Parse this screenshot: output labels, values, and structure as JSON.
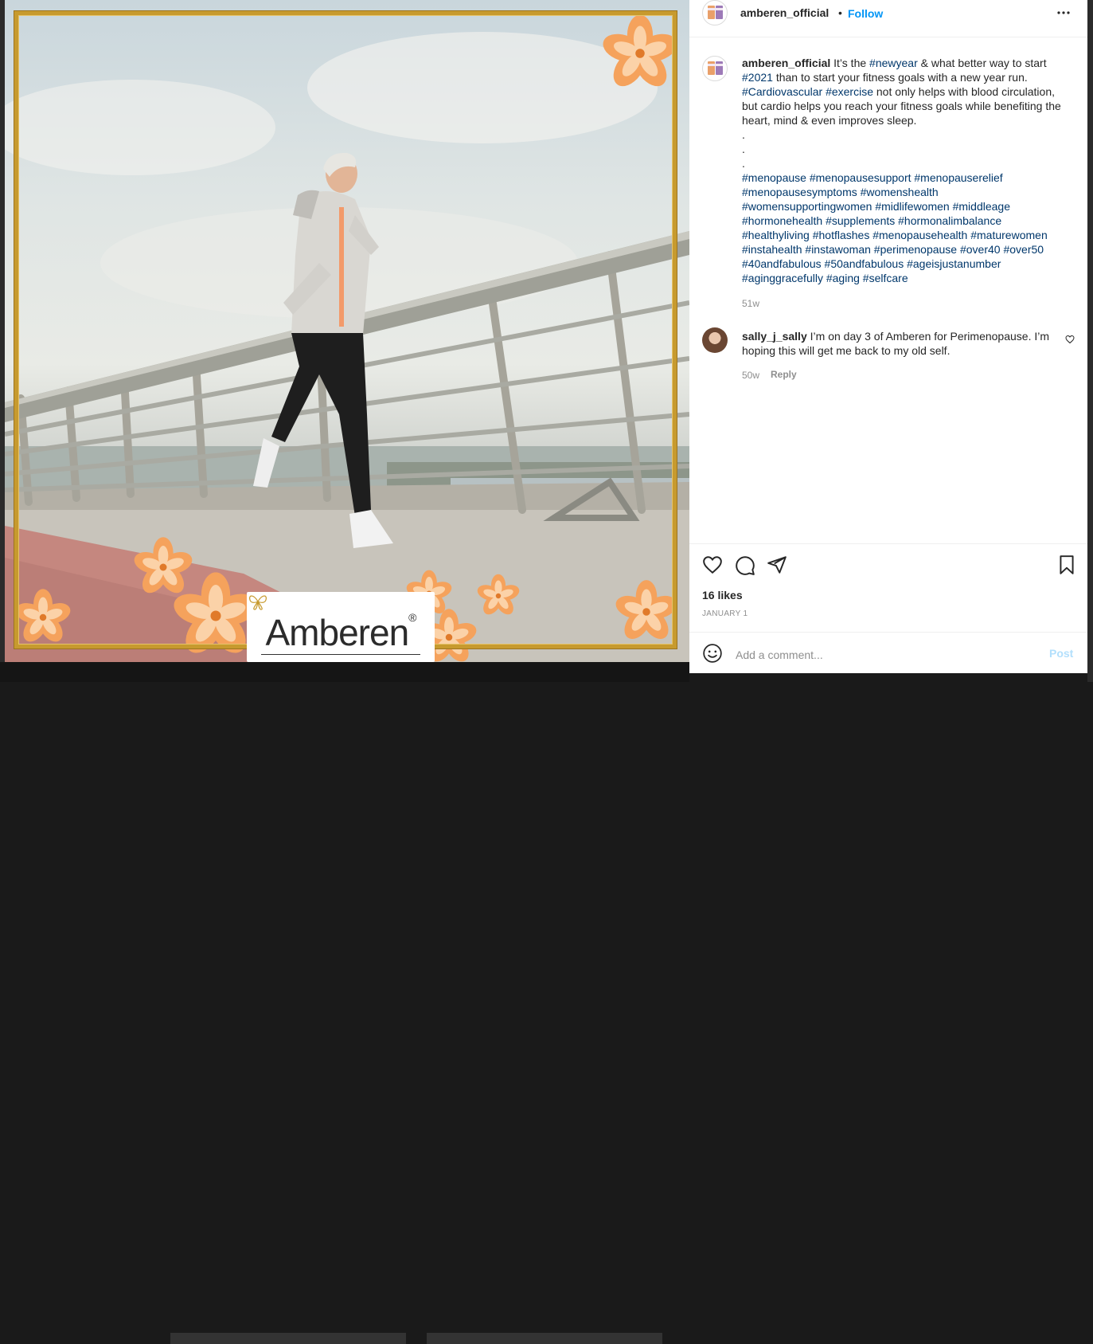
{
  "post": {
    "logo_text": "Amberen",
    "logo_mark": "®"
  },
  "header": {
    "username": "amberen_official",
    "separator": "•",
    "follow_label": "Follow",
    "more_icon": "more-horizontal-icon"
  },
  "caption": {
    "username": "amberen_official",
    "segments": [
      {
        "t": "It’s the "
      },
      {
        "t": "#newyear",
        "tag": true
      },
      {
        "t": " & what better way to start "
      },
      {
        "t": "#2021",
        "tag": true
      },
      {
        "t": " than to start your fitness goals with a new year run. "
      },
      {
        "t": "#Cardiovascular",
        "tag": true
      },
      {
        "t": " "
      },
      {
        "t": "#exercise",
        "tag": true
      },
      {
        "t": " not only helps with blood circulation, but cardio helps you reach your fitness goals while benefiting the heart, mind & even improves sleep.\n.\n.\n.\n"
      }
    ],
    "hashtag_lines": [
      [
        "#menopause",
        "#menopausesupport",
        "#menopauserelief"
      ],
      [
        "#menopausesymptoms",
        "#womenshealth"
      ],
      [
        "#womensupportingwomen",
        "#midlifewomen",
        "#middleage"
      ],
      [
        "#hormonehealth",
        "#supplements",
        "#hormonalimbalance"
      ],
      [
        "#healthyliving",
        "#hotflashes",
        "#menopausehealth",
        "#maturewomen"
      ],
      [
        "#instahealth",
        "#instawoman",
        "#perimenopause",
        "#over40",
        "#over50"
      ],
      [
        "#40andfabulous",
        "#50andfabulous",
        "#ageisjustanumber"
      ],
      [
        "#aginggracefully",
        "#aging",
        "#selfcare"
      ]
    ],
    "time": "51w"
  },
  "comment": {
    "username": "sally_j_sally",
    "text": "I’m on day 3 of Amberen for Perimenopause. I’m hoping this will get me back to my old self.",
    "time": "50w",
    "reply_label": "Reply"
  },
  "actions": {
    "likes": "16 likes",
    "date": "JANUARY 1"
  },
  "comment_box": {
    "placeholder": "Add a comment...",
    "post_label": "Post"
  },
  "colors": {
    "accent": "#0095f6",
    "hashtag": "#00376b",
    "muted": "#8e8e8e",
    "gold_frame": "#c79a2e",
    "flower": "#f5a25c"
  }
}
